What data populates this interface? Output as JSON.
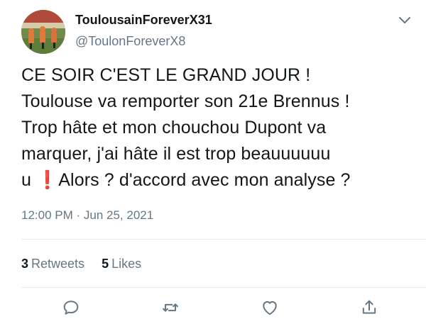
{
  "user": {
    "display_name": "ToulousainForeverX31",
    "handle": "@ToulonForeverX8"
  },
  "tweet": {
    "text": "CE SOIR C'EST LE GRAND JOUR !\nToulouse va remporter son 21e Brennus !\nTrop hâte et mon chouchou Dupont va\nmarquer, j'ai hâte il est trop beauuuuuu\nu ❗Alors ? d'accord avec mon analyse ?",
    "timestamp": "12:00 PM · Jun 25, 2021"
  },
  "stats": {
    "retweets_count": "3",
    "retweets_label": "Retweets",
    "likes_count": "5",
    "likes_label": "Likes"
  },
  "icons": {
    "caret": "chevron-down-icon",
    "reply": "reply-icon",
    "retweet": "retweet-icon",
    "like": "heart-icon",
    "share": "share-icon"
  },
  "colors": {
    "text": "#14171a",
    "secondary": "#657786",
    "divider": "#e6ecf0"
  }
}
